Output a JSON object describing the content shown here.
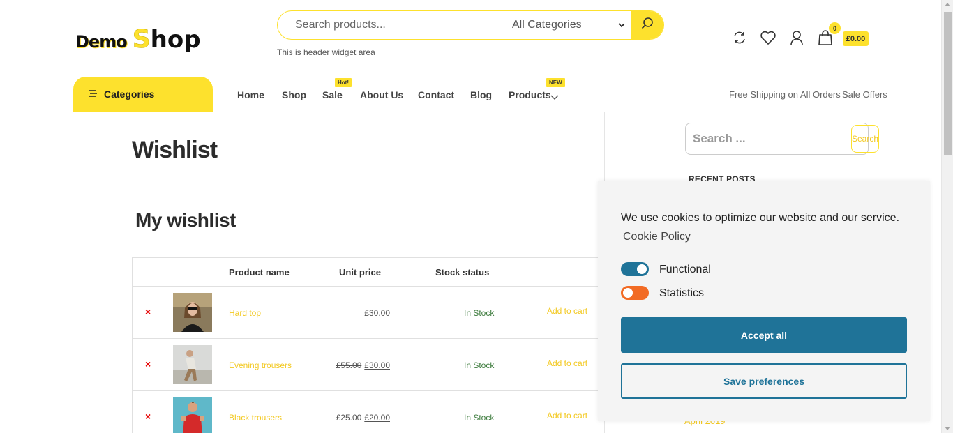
{
  "header": {
    "logo_part1": "Demo",
    "logo_s": "S",
    "logo_part2": "hop",
    "search_placeholder": "Search products...",
    "category_select": "All Categories",
    "widget_area": "This is header widget area",
    "cart_count": "0",
    "cart_total": "£0.00",
    "icons": [
      "compare-icon",
      "heart-icon",
      "user-icon",
      "bag-icon",
      "search-icon"
    ]
  },
  "nav": {
    "categories_label": "Categories",
    "items": [
      {
        "label": "Home"
      },
      {
        "label": "Shop"
      },
      {
        "label": "Sale",
        "badge": "Hot!"
      },
      {
        "label": "About Us"
      },
      {
        "label": "Contact"
      },
      {
        "label": "Blog"
      },
      {
        "label": "Products",
        "badge": "NEW"
      }
    ],
    "right": [
      "Free Shipping on All Orders",
      "Sale Offers"
    ]
  },
  "main": {
    "page_title": "Wishlist",
    "section_title": "My wishlist",
    "columns": [
      "Product name",
      "Unit price",
      "Stock status"
    ],
    "rows": [
      {
        "remove": "×",
        "name": "Hard top",
        "price_old": "",
        "price": "£30.00",
        "stock": "In Stock",
        "action": "Add to cart"
      },
      {
        "remove": "×",
        "name": "Evening trousers",
        "price_old": "£55.00",
        "price": "£30.00",
        "stock": "In Stock",
        "action": "Add to cart"
      },
      {
        "remove": "×",
        "name": "Black trousers",
        "price_old": "£25.00",
        "price": "£20.00",
        "stock": "In Stock",
        "action": "Add to cart"
      }
    ]
  },
  "sidebar": {
    "search_placeholder": "Search ...",
    "search_button": "Search",
    "recent_posts": "RECENT POSTS",
    "archive_link": "April 2019"
  },
  "cookie": {
    "message": "We use cookies to optimize our website and our service.",
    "policy_link": "Cookie Policy",
    "toggles": [
      {
        "label": "Functional",
        "state": "on",
        "color": "#1f7398"
      },
      {
        "label": "Statistics",
        "state": "off",
        "color": "#f26b24"
      }
    ],
    "accept_label": "Accept all",
    "save_label": "Save preferences"
  },
  "colors": {
    "brand_yellow": "#fde12d",
    "link_yellow": "#f3c921",
    "cookie_blue": "#1f7398",
    "remove_red": "#e60000",
    "stock_green": "#3e7c3e"
  }
}
